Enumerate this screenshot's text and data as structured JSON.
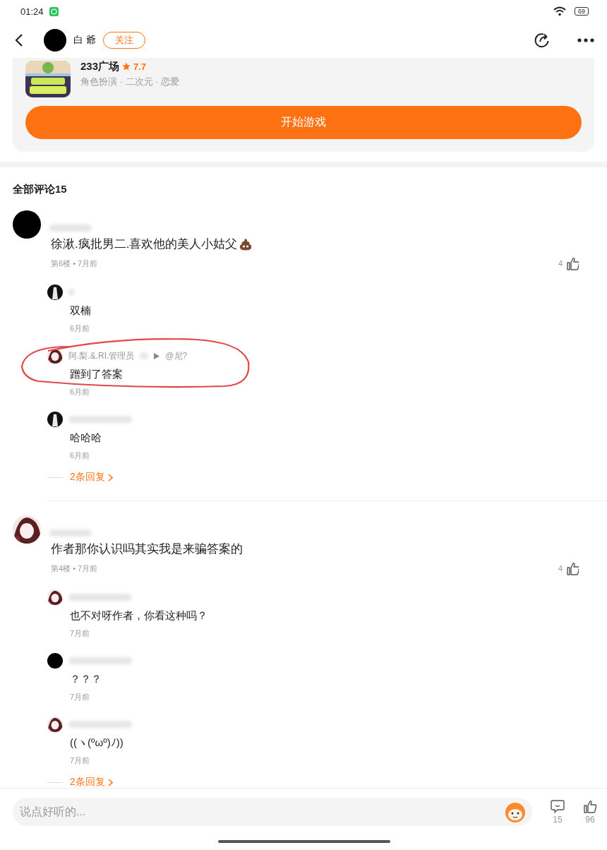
{
  "status_bar": {
    "time": "01:24",
    "battery": "69"
  },
  "header": {
    "author": "白 爺",
    "follow_button": "关注"
  },
  "game_card": {
    "title": "233广场",
    "rating": "7.7",
    "tags": "角色扮演 · 二次元 · 恋爱",
    "play_button": "开始游戏"
  },
  "comments_title": "全部评论15",
  "comments": [
    {
      "avatar": {
        "kind": "black"
      },
      "text": "徐湫.疯批男二.喜欢他的美人小姑父",
      "meta": "第6楼 • 7月前",
      "likes": "4",
      "more_replies": "2条回复",
      "replies": [
        {
          "avatar": {
            "kind": "figure"
          },
          "text": "双楠",
          "time": "6月前"
        },
        {
          "name": "阿.梨.&.RI.管理员",
          "reply_to": "@尼?",
          "text": "蹭到了答案",
          "time": "6月前",
          "circled": true
        },
        {
          "avatar": {
            "kind": "figure"
          },
          "text": "哈哈哈",
          "time": "6月前"
        }
      ]
    },
    {
      "text": "作者那你认识吗其实我是来骗答案的",
      "meta": "第4楼 • 7月前",
      "likes": "4",
      "more_replies": "2条回复",
      "replies": [
        {
          "text": "也不对呀作者，你看这种吗？",
          "time": "7月前"
        },
        {
          "avatar": {
            "kind": "black"
          },
          "text": "？？？",
          "time": "7月前"
        },
        {
          "text": "((ヽ(ºωº)ﾉ))",
          "time": "7月前"
        }
      ]
    }
  ],
  "bottom_bar": {
    "placeholder": "说点好听的...",
    "comment_count": "15",
    "like_count": "96"
  }
}
